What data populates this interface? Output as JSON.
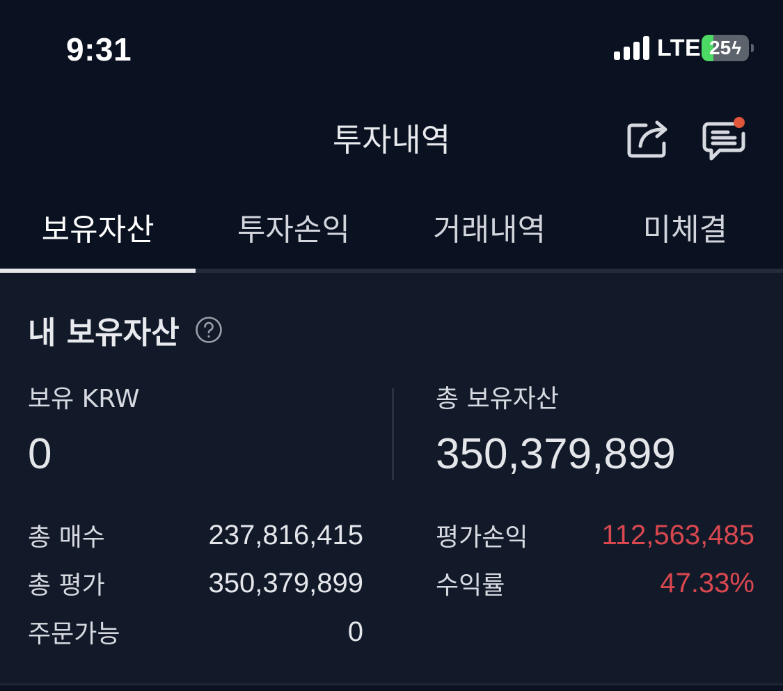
{
  "status_bar": {
    "time": "9:31",
    "network": "LTE",
    "battery_level": "25",
    "battery_fraction": 0.25,
    "icons": [
      "cellular-signal-icon",
      "battery-charging-icon"
    ]
  },
  "header": {
    "title": "투자내역",
    "actions": [
      "share-icon",
      "chat-icon"
    ],
    "notification_dot_color": "#e0573c"
  },
  "tabs": [
    {
      "label": "보유자산",
      "active": true
    },
    {
      "label": "투자손익",
      "active": false
    },
    {
      "label": "거래내역",
      "active": false
    },
    {
      "label": "미체결",
      "active": false
    }
  ],
  "holdings": {
    "title": "내 보유자산",
    "help_icon": "question-circle-icon",
    "krw_label": "보유 KRW",
    "krw_value": "0",
    "total_label": "총 보유자산",
    "total_value": "350,379,899",
    "details_left": [
      {
        "label": "총 매수",
        "value": "237,816,415"
      },
      {
        "label": "총 평가",
        "value": "350,379,899"
      },
      {
        "label": "주문가능",
        "value": "0"
      }
    ],
    "details_right": [
      {
        "label": "평가손익",
        "value": "112,563,485",
        "color": "#d9474f"
      },
      {
        "label": "수익률",
        "value": "47.33%",
        "color": "#d9474f"
      }
    ]
  },
  "colors": {
    "background": "#0a1120",
    "panel": "#121a2a",
    "profit_red": "#d9474f",
    "battery_green": "#4cd964"
  }
}
